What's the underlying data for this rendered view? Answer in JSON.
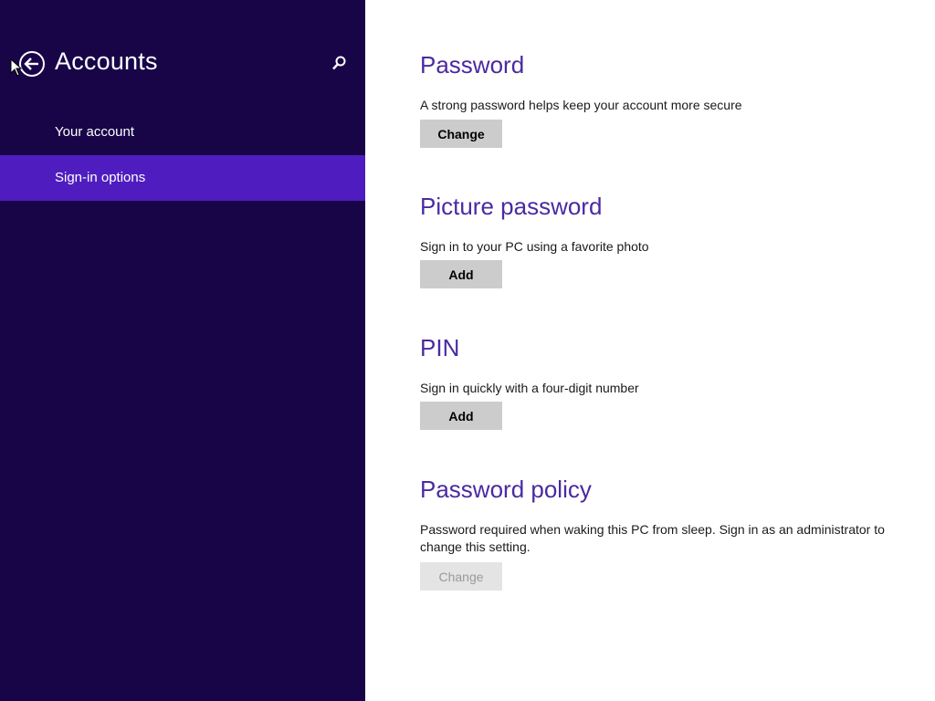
{
  "sidebar": {
    "title": "Accounts",
    "back_icon": "back-arrow-circle-icon",
    "search_icon": "search-icon",
    "items": [
      {
        "label": "Your account",
        "active": false
      },
      {
        "label": "Sign-in options",
        "active": true
      }
    ]
  },
  "colors": {
    "sidebar_bg": "#180548",
    "sidebar_active": "#4f1dbf",
    "heading": "#4b2aa0",
    "button_bg": "#cccccc",
    "button_disabled_bg": "#e4e4e4"
  },
  "sections": [
    {
      "title": "Password",
      "description": "A strong password helps keep your account more secure",
      "button_label": "Change",
      "button_enabled": true
    },
    {
      "title": "Picture password",
      "description": "Sign in to your PC using a favorite photo",
      "button_label": "Add",
      "button_enabled": true
    },
    {
      "title": "PIN",
      "description": "Sign in quickly with a four-digit number",
      "button_label": "Add",
      "button_enabled": true
    },
    {
      "title": "Password policy",
      "description": "Password required when waking this PC from sleep. Sign in as an administrator to change this setting.",
      "button_label": "Change",
      "button_enabled": false
    }
  ]
}
